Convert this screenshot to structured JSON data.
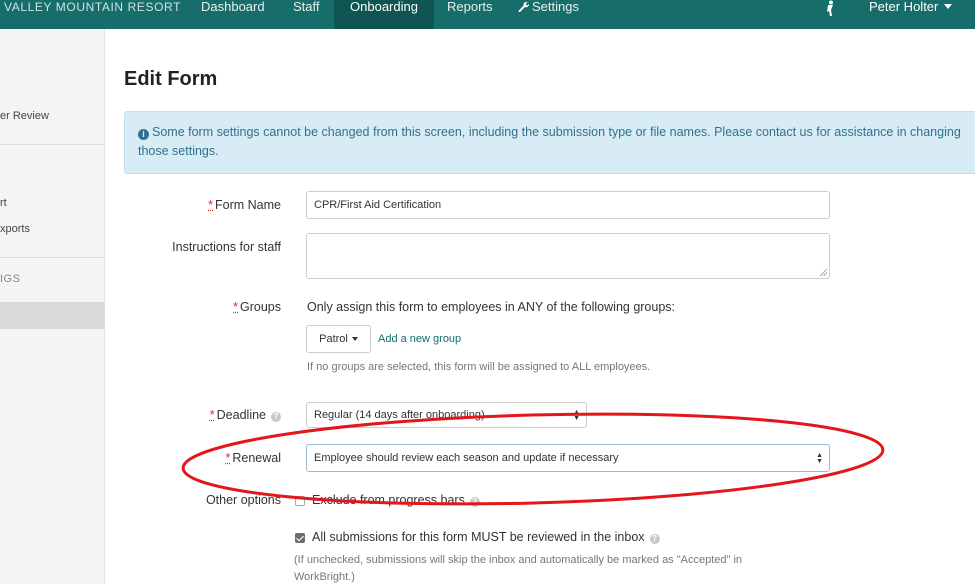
{
  "nav": {
    "brand": "VALLEY MOUNTAIN RESORT",
    "items": [
      {
        "label": "Dashboard"
      },
      {
        "label": "Staff"
      },
      {
        "label": "Onboarding"
      },
      {
        "label": "Reports"
      },
      {
        "label": "Settings"
      }
    ],
    "user": "Peter Holter"
  },
  "sidebar": {
    "items": [
      "er Review",
      "rt",
      "xports"
    ],
    "section_header": "IGS"
  },
  "page": {
    "title": "Edit Form",
    "alert": "Some form settings cannot be changed from this screen, including the submission type or file names. Please contact us for assistance in changing those settings."
  },
  "form": {
    "form_name": {
      "label": "Form Name",
      "value": "CPR/First Aid Certification"
    },
    "instructions": {
      "label": "Instructions for staff",
      "value": ""
    },
    "groups": {
      "label": "Groups",
      "description": "Only assign this form to employees in ANY of the following groups:",
      "selected": "Patrol",
      "add_link": "Add a new group",
      "hint": "If no groups are selected, this form will be assigned to ALL employees."
    },
    "deadline": {
      "label": "Deadline",
      "value": "Regular (14 days after onboarding)"
    },
    "renewal": {
      "label": "Renewal",
      "value": "Employee should review each season and update if necessary"
    },
    "other_options": {
      "label": "Other options",
      "exclude_progress": {
        "label": "Exclude from progress bars",
        "checked": false
      },
      "must_review": {
        "label": "All submissions for this form MUST be reviewed in the inbox",
        "checked": true
      },
      "must_review_hint_1": "(If unchecked, submissions will skip the inbox and automatically be marked as \"Accepted\" in",
      "must_review_hint_2": "WorkBright.)"
    }
  },
  "colors": {
    "nav_bg": "#176d69",
    "annotation": "#e3161b",
    "alert_bg": "#d8ecf5"
  }
}
